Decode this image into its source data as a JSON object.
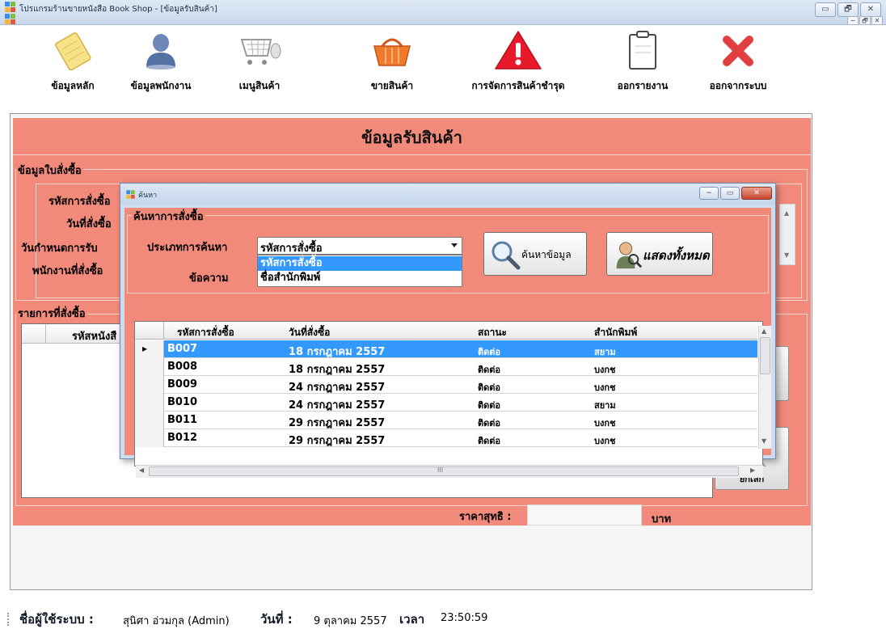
{
  "window": {
    "title": "โปรแกรมร้านขายหนังสือ Book Shop - [ข้อมูลรับสินค้า]",
    "controls": {
      "minimize": "▭",
      "restore": "🗗",
      "close": "✕"
    },
    "mdi_controls": {
      "minimize": "−",
      "restore": "🗗",
      "close": "✕"
    }
  },
  "toolbar": {
    "items": [
      {
        "label": "ข้อมูลหลัก",
        "icon": "notepad-icon"
      },
      {
        "label": "ข้อมูลพนักงาน",
        "icon": "person-icon"
      },
      {
        "label": "เมนูสินค้า",
        "icon": "cart-icon"
      },
      {
        "label": "ขายสินค้า",
        "icon": "basket-icon"
      },
      {
        "label": "การจัดการสินค้าชำรุด",
        "icon": "warning-icon"
      },
      {
        "label": "ออกรายงาน",
        "icon": "clipboard-icon"
      },
      {
        "label": "ออกจากระบบ",
        "icon": "red-x-icon"
      }
    ]
  },
  "form": {
    "title": "ข้อมูลรับสินค้า",
    "order_group": {
      "title": "ข้อมูลใบสั่งซื้อ",
      "labels": [
        "รหัสการสั่งซื้อ",
        "วันที่สั่งซื้อ",
        "วันกำหนดการรับ",
        "พนักงานที่สั่งซื้อ"
      ]
    },
    "items_group": {
      "title": "รายการที่สั่งซื้อ",
      "column_header": "รหัสหนังสื"
    },
    "cancel_label": "ยกเลิก",
    "net_price_label": "ราคาสุทธิ :",
    "net_price_value": "",
    "currency": "บาท"
  },
  "dialog": {
    "title": "ค้นหา",
    "group_title": "ค้นหาการสั่งซื้อ",
    "search_type_label": "ประเภทการค้นหา",
    "search_type_selected": "รหัสการสั่งซื้อ",
    "search_type_options": [
      "รหัสการสั่งซื้อ",
      "ชื่อสำนักพิมพ์"
    ],
    "text_label": "ข้อความ",
    "search_button": "ค้นหาข้อมูล",
    "show_all_button": "แสดงทั้งหมด",
    "grid": {
      "columns": [
        "รหัสการสั่งซื้อ",
        "วันที่สั่งซื้อ",
        "สถานะ",
        "สำนักพิมพ์"
      ],
      "rows": [
        {
          "id": "B007",
          "date": "18 กรกฎาคม 2557",
          "status": "ติดต่อ",
          "publisher": "สยาม"
        },
        {
          "id": "B008",
          "date": "18 กรกฎาคม 2557",
          "status": "ติดต่อ",
          "publisher": "บงกช"
        },
        {
          "id": "B009",
          "date": "24 กรกฎาคม 2557",
          "status": "ติดต่อ",
          "publisher": "บงกช"
        },
        {
          "id": "B010",
          "date": "24 กรกฎาคม 2557",
          "status": "ติดต่อ",
          "publisher": "สยาม"
        },
        {
          "id": "B011",
          "date": "29 กรกฎาคม 2557",
          "status": "ติดต่อ",
          "publisher": "บงกช"
        },
        {
          "id": "B012",
          "date": "29 กรกฎาคม 2557",
          "status": "ติดต่อ",
          "publisher": "บงกช"
        }
      ],
      "selected_row": 0,
      "current_row_marker": "▸",
      "hscroll_grip": "III"
    }
  },
  "statusbar": {
    "user_label": "ชื่อผู้ใช้ระบบ :",
    "user_value": "สุนิศา อ่วมกุล  (Admin)",
    "date_label": "วันที่ :",
    "date_value": "9 ตุลาคม 2557",
    "time_label": "เวลา",
    "time_value": "23:50:59"
  },
  "colors": {
    "form_bg": "#f28a7c",
    "selection": "#3399ff",
    "title_bar": "#c8d8ec"
  }
}
